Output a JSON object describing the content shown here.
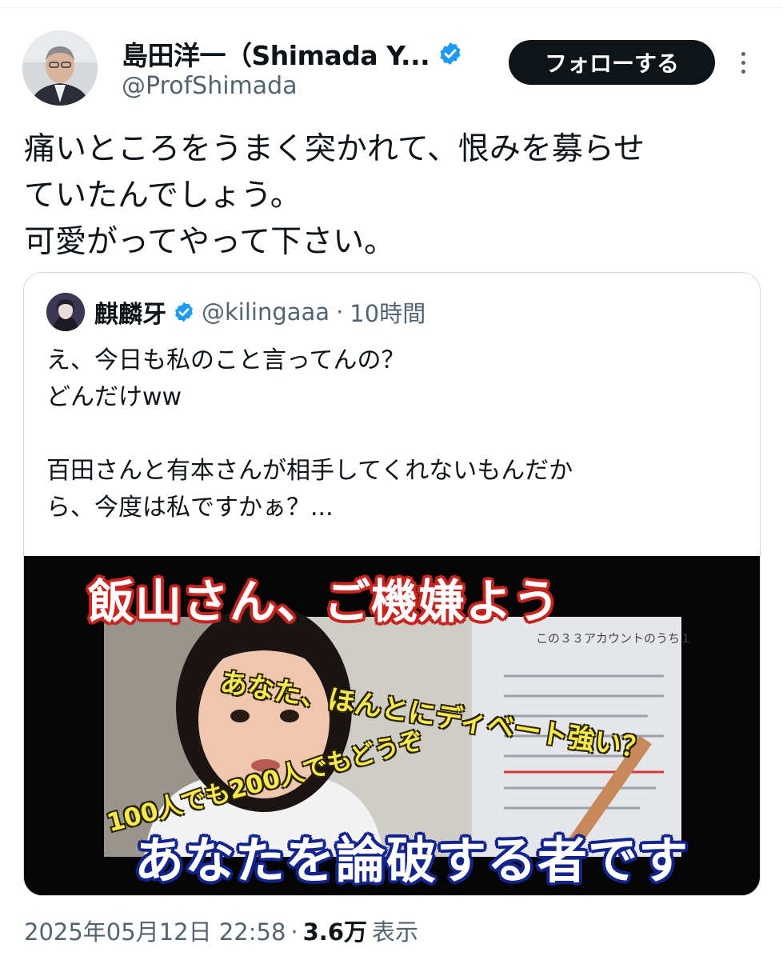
{
  "author": {
    "name": "島田洋一（Shimada Y...",
    "handle": "@ProfShimada",
    "verified": true
  },
  "follow_button": {
    "label": "フォローする"
  },
  "more_button": {
    "icon": "more-vertical-icon"
  },
  "tweet": {
    "lines": [
      "痛いところをうまく突かれて、恨みを募らせ",
      "ていたんでしょう。",
      "可愛がってやって下さい。"
    ]
  },
  "quote": {
    "name": "麒麟牙",
    "verified": true,
    "handle": "@kilingaaa",
    "separator": "·",
    "time": "10時間",
    "lines": [
      "え、今日も私のこと言ってんの？",
      "どんだけww",
      "",
      "百田さんと有本さんが相手してくれないもんだか",
      "ら、今度は私ですかぁ？..."
    ],
    "media": {
      "title": "飯山さん、ご機嫌よう",
      "caption_1": "あなた、ほんとにディベート強い？",
      "caption_2": "100人でも200人でもどうぞ",
      "bottom": "あなたを論破する者です",
      "doc_title": "この３３アカウントのうち１"
    }
  },
  "footer": {
    "datetime": "2025年05月12日 22:58",
    "separator": "·",
    "views": "3.6万",
    "views_label": "表示"
  },
  "colors": {
    "text": "#0f1419",
    "secondary": "#536471",
    "verified": "#1d9bf0",
    "follow_bg": "#0f1419",
    "border": "#cfd9de"
  }
}
